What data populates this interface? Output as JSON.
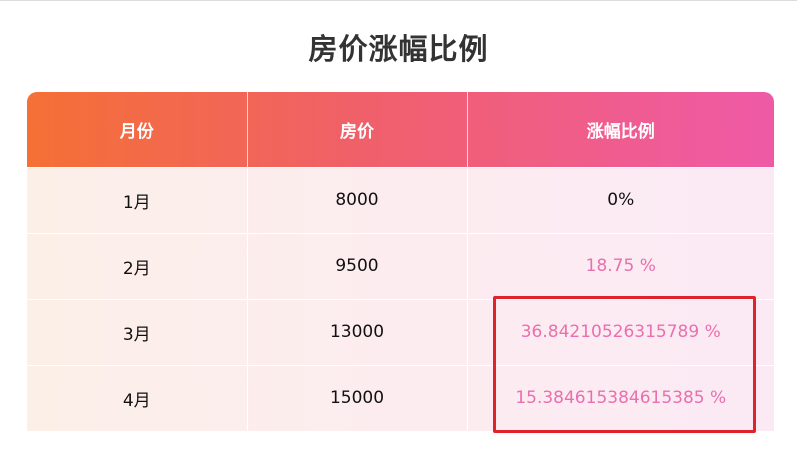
{
  "title": "房价涨幅比例",
  "table": {
    "headers": [
      "月份",
      "房价",
      "涨幅比例"
    ],
    "rows": [
      {
        "month": "1月",
        "price": "8000",
        "change": "0%"
      },
      {
        "month": "2月",
        "price": "9500",
        "change": "18.75 %"
      },
      {
        "month": "3月",
        "price": "13000",
        "change": "36.84210526315789 %"
      },
      {
        "month": "4月",
        "price": "15000",
        "change": "15.384615384615385 %"
      }
    ]
  },
  "colors": {
    "header_gradient_start": "#f47035",
    "header_gradient_end": "#ef5aa6",
    "pink_text": "#ea6fae",
    "highlight_border": "#e0232a"
  }
}
